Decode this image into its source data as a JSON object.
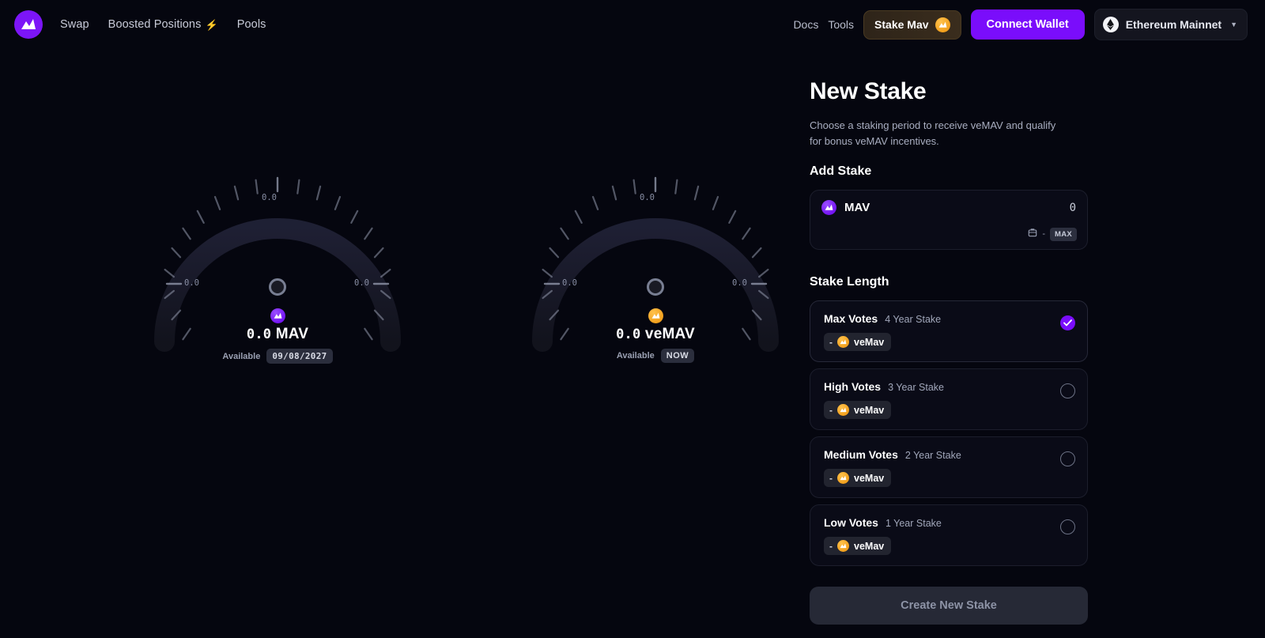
{
  "header": {
    "logo_icon": "maverick-logo-icon",
    "nav": [
      {
        "label": "Swap"
      },
      {
        "label": "Boosted Positions",
        "badge_icon": "bolt-icon"
      },
      {
        "label": "Pools"
      }
    ],
    "links": [
      {
        "label": "Docs"
      },
      {
        "label": "Tools"
      }
    ],
    "stake_button": {
      "label": "Stake Mav",
      "icon": "mav-coin-icon"
    },
    "connect_button": {
      "label": "Connect Wallet"
    },
    "network": {
      "label": "Ethereum Mainnet",
      "icon": "ethereum-icon",
      "caret": "▼"
    }
  },
  "gauges": [
    {
      "id": "mav-gauge",
      "token_icon": "mav-token-icon",
      "value": "0.0",
      "unit": "MAV",
      "available_label": "Available",
      "available_value": "09/08/2027",
      "tick_labels": [
        "0.0",
        "0.0",
        "0.0"
      ]
    },
    {
      "id": "vemav-gauge",
      "token_icon": "vemav-token-icon",
      "value": "0.0",
      "unit": "veMAV",
      "available_label": "Available",
      "available_value": "NOW",
      "tick_labels": [
        "0.0",
        "0.0",
        "0.0"
      ]
    }
  ],
  "panel": {
    "title": "New Stake",
    "description": "Choose a staking period to receive veMAV and qualify for bonus veMAV incentives.",
    "add_stake": {
      "section_title": "Add Stake",
      "token_symbol": "MAV",
      "token_icon": "mav-token-icon",
      "amount": "0",
      "wallet_icon": "wallet-icon",
      "wallet_balance": "-",
      "max_label": "MAX"
    },
    "stake_length": {
      "section_title": "Stake Length",
      "options": [
        {
          "name": "Max Votes",
          "term": "4 Year Stake",
          "reward": "-",
          "reward_token": "veMav",
          "selected": true
        },
        {
          "name": "High Votes",
          "term": "3 Year Stake",
          "reward": "-",
          "reward_token": "veMav",
          "selected": false
        },
        {
          "name": "Medium Votes",
          "term": "2 Year Stake",
          "reward": "-",
          "reward_token": "veMav",
          "selected": false
        },
        {
          "name": "Low Votes",
          "term": "1 Year Stake",
          "reward": "-",
          "reward_token": "veMav",
          "selected": false
        }
      ]
    },
    "create_button": {
      "label": "Create New Stake",
      "disabled": true
    }
  },
  "colors": {
    "background": "#05060f",
    "accent_purple": "#7a0dfb",
    "accent_orange": "#f2a01d",
    "card": "#0a0b17",
    "card_border": "#1c1e2c"
  }
}
